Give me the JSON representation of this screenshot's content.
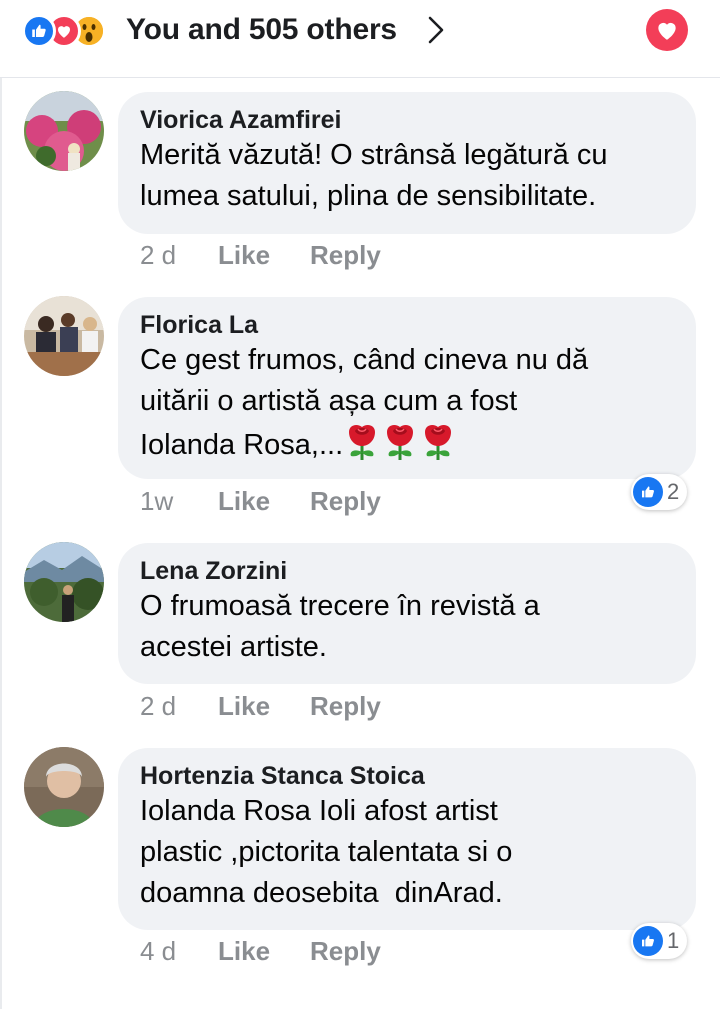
{
  "header": {
    "reaction_summary": "You and 505 others",
    "reaction_icons": [
      "like-icon",
      "love-icon",
      "wow-icon"
    ],
    "colors": {
      "like": "#1877f2",
      "love": "#f33e58",
      "wow": "#f7b125"
    }
  },
  "comments": [
    {
      "name": "Viorica Azamfirei",
      "lines": [
        "Merită văzută! O strânsă legătură cu",
        "lumea satului, plina de sensibilitate."
      ],
      "time": "2 d",
      "like_label": "Like",
      "reply_label": "Reply"
    },
    {
      "name": "Florica La",
      "lines": [
        "Ce gest frumos, când cineva nu dă",
        "uitării o artistă așa cum a fost",
        "Iolanda Rosa,..."
      ],
      "emoji": [
        "rose-emoji",
        "rose-emoji",
        "rose-emoji"
      ],
      "time": "1w",
      "like_label": "Like",
      "reply_label": "Reply",
      "reaction_count": "2"
    },
    {
      "name": "Lena Zorzini",
      "lines": [
        "O frumoasă trecere în revistă a",
        "acestei artiste."
      ],
      "time": "2 d",
      "like_label": "Like",
      "reply_label": "Reply"
    },
    {
      "name": "Hortenzia Stanca Stoica",
      "lines": [
        "Iolanda Rosa Ioli afost artist",
        "plastic ,pictorita talentata si o",
        "doamna deosebita  dinArad."
      ],
      "time": "4 d",
      "like_label": "Like",
      "reply_label": "Reply",
      "reaction_count": "1"
    }
  ]
}
